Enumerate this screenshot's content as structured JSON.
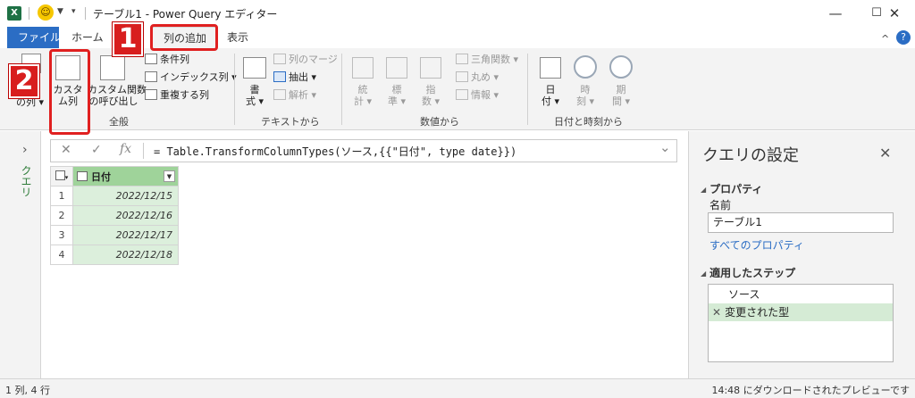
{
  "window": {
    "app_glyph": "X",
    "title": "テーブル1 - Power Query エディター",
    "controls": {
      "minimize": "—",
      "maximize": "☐",
      "close": "✕"
    }
  },
  "tabs": {
    "file": "ファイル",
    "home": "ホーム",
    "add_column": "列の追加",
    "view": "表示"
  },
  "ribbon": {
    "general": {
      "label": "全般",
      "custom_column": [
        "カスタ",
        "ム列"
      ],
      "invoke_custom_function": [
        "カスタム関数",
        "の呼び出し"
      ],
      "conditional_column": "条件列",
      "index_column": "インデックス列 ▾",
      "duplicate_column": "重複する列",
      "partial_left": "の列 ▾"
    },
    "text": {
      "label": "テキストから",
      "format": [
        "書",
        "式 ▾"
      ],
      "merge_columns": "列のマージ",
      "extract": "抽出 ▾",
      "parse": "解析 ▾"
    },
    "number": {
      "label": "数値から",
      "statistics": [
        "統",
        "計 ▾"
      ],
      "standard": [
        "標",
        "準 ▾"
      ],
      "scientific": [
        "指",
        "数 ▾"
      ],
      "trigonometry": "三角関数 ▾",
      "rounding": "丸め ▾",
      "information": "情報 ▾"
    },
    "datetime": {
      "label": "日付と時刻から",
      "date": [
        "日",
        "付 ▾"
      ],
      "time": [
        "時",
        "刻 ▾"
      ],
      "duration": [
        "期",
        "間 ▾"
      ]
    }
  },
  "callouts": {
    "one": "1",
    "two": "2"
  },
  "left_pane": {
    "chevron": "›",
    "label": "クエリ"
  },
  "formula": {
    "cancel": "✕",
    "commit": "✓",
    "fx": "fx",
    "text": "= Table.TransformColumnTypes(ソース,{{\"日付\", type date}})",
    "expand": "⌄"
  },
  "grid": {
    "column_header": "日付",
    "rows": [
      {
        "num": "1",
        "value": "2022/12/15"
      },
      {
        "num": "2",
        "value": "2022/12/16"
      },
      {
        "num": "3",
        "value": "2022/12/17"
      },
      {
        "num": "4",
        "value": "2022/12/18"
      }
    ]
  },
  "settings": {
    "title": "クエリの設定",
    "close": "✕",
    "properties_header": "プロパティ",
    "name_label": "名前",
    "name_value": "テーブル1",
    "all_properties": "すべてのプロパティ",
    "steps_header": "適用したステップ",
    "steps": [
      {
        "label": "ソース",
        "selected": false
      },
      {
        "label": "変更された型",
        "selected": true,
        "mark": "✕"
      }
    ]
  },
  "status": {
    "left": "1 列, 4 行",
    "right": "14:48 にダウンロードされたプレビューです"
  },
  "colors": {
    "accent_blue": "#2b6dc4",
    "callout_red": "#d81e1e",
    "column_green": "#9fd39a",
    "selected_step": "#d5ebd5"
  }
}
